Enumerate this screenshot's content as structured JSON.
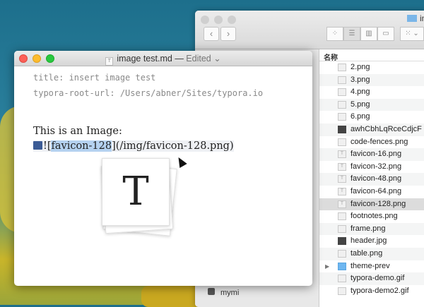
{
  "finder": {
    "title": "in",
    "column_header": "名称",
    "sidebar_item": "mymi",
    "files": [
      {
        "name": "2.png",
        "icon": "image-file-icon"
      },
      {
        "name": "3.png",
        "icon": "image-file-icon"
      },
      {
        "name": "4.png",
        "icon": "image-file-icon"
      },
      {
        "name": "5.png",
        "icon": "image-file-icon"
      },
      {
        "name": "6.png",
        "icon": "image-file-icon"
      },
      {
        "name": "awhCbhLqRceCdjcF",
        "icon": "dark-image-file-icon"
      },
      {
        "name": "code-fences.png",
        "icon": "image-file-icon"
      },
      {
        "name": "favicon-16.png",
        "icon": "typora-file-icon"
      },
      {
        "name": "favicon-32.png",
        "icon": "typora-file-icon"
      },
      {
        "name": "favicon-48.png",
        "icon": "typora-file-icon"
      },
      {
        "name": "favicon-64.png",
        "icon": "typora-file-icon"
      },
      {
        "name": "favicon-128.png",
        "icon": "typora-file-icon",
        "selected": true
      },
      {
        "name": "footnotes.png",
        "icon": "image-file-icon"
      },
      {
        "name": "frame.png",
        "icon": "image-file-icon"
      },
      {
        "name": "header.jpg",
        "icon": "dark-image-file-icon"
      },
      {
        "name": "table.png",
        "icon": "image-file-icon"
      },
      {
        "name": "theme-prev",
        "icon": "folder-icon"
      },
      {
        "name": "typora-demo.gif",
        "icon": "image-file-icon"
      },
      {
        "name": "typora-demo2.gif",
        "icon": "image-file-icon"
      }
    ]
  },
  "editor": {
    "filename": "image test.md",
    "separator": "—",
    "status": "Edited ⌄",
    "yaml": [
      "title: insert image test",
      "typora-root-url: /Users/abner/Sites/typora.io"
    ],
    "paragraph": "This is an Image:",
    "image_md": {
      "open": "![",
      "alt": "favicon-128",
      "mid": "](/img/favicon-128.png)"
    },
    "preview_letter": "T"
  }
}
